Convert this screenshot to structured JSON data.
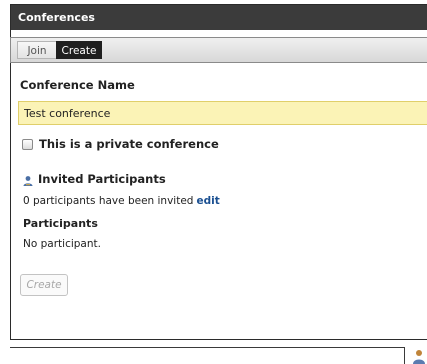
{
  "dialog": {
    "title": "Conferences"
  },
  "tabs": [
    {
      "label": "Join",
      "active": false
    },
    {
      "label": "Create",
      "active": true
    }
  ],
  "form": {
    "name_label": "Conference Name",
    "name_value": "Test conference",
    "private_label": "This is a private conference",
    "private_checked": false
  },
  "invited": {
    "title": "Invited Participants",
    "count_text": "0 participants have been invited",
    "edit_label": "edit",
    "participants_label": "Participants",
    "empty_text": "No participant."
  },
  "actions": {
    "create_label": "Create"
  },
  "colors": {
    "titlebar": "#3b3b3b",
    "active_tab": "#1f1f1f",
    "input_highlight": "#fbf3b6",
    "link": "#1a4f91"
  },
  "icons": {
    "invited": "person-icon",
    "corner": "user-icon"
  }
}
